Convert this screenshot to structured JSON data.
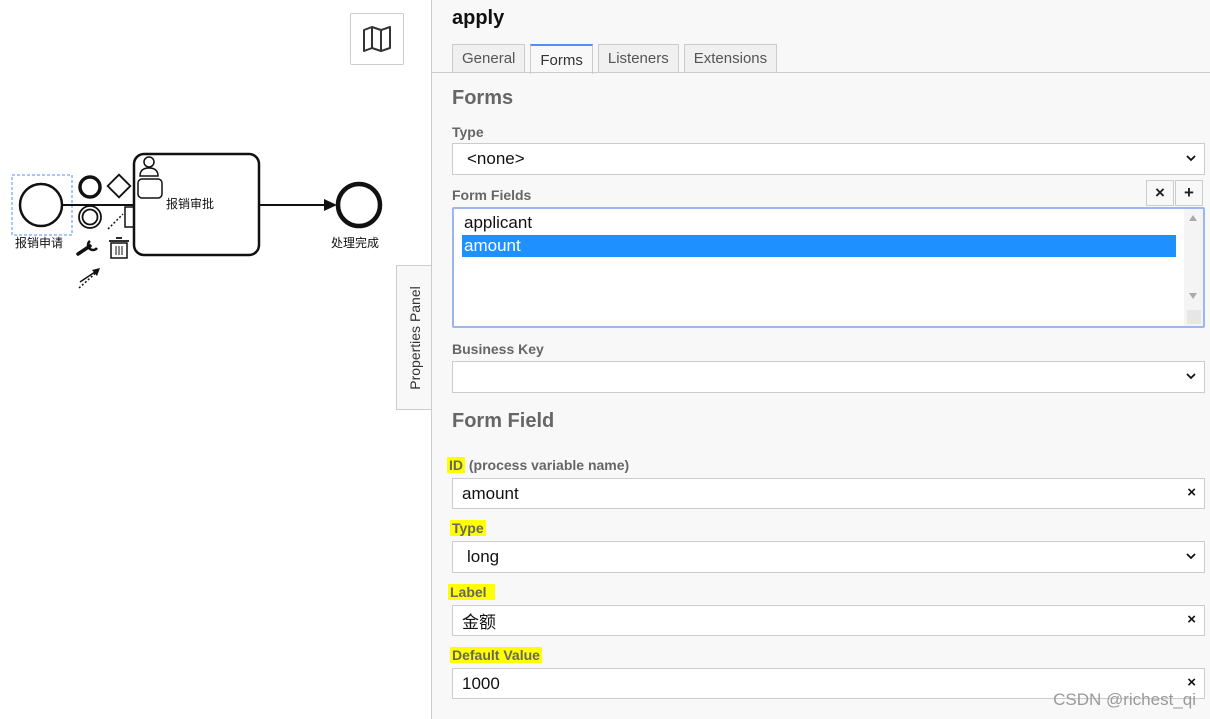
{
  "diagram": {
    "start_event_label": "报销申请",
    "user_task_label": "报销审批",
    "end_event_label": "处理完成",
    "minimap_icon": "map-icon",
    "panel_toggle_label": "Properties Panel"
  },
  "panel": {
    "title": "apply",
    "tabs": [
      {
        "label": "General"
      },
      {
        "label": "Forms"
      },
      {
        "label": "Listeners"
      },
      {
        "label": "Extensions"
      }
    ],
    "active_tab": "Forms",
    "forms_section_title": "Forms",
    "type_label": "Type",
    "type_value": "<none>",
    "form_fields_label": "Form Fields",
    "remove_button": "×",
    "add_button": "+",
    "form_fields": [
      {
        "label": "applicant"
      },
      {
        "label": "amount"
      }
    ],
    "selected_field": "amount",
    "business_key_label": "Business Key",
    "business_key_value": "",
    "form_field_section_title": "Form Field",
    "id_label": "ID",
    "id_label_suffix": "(process variable name)",
    "id_value": "amount",
    "field_type_label": "Type",
    "field_type_value": "long",
    "label_label": "Label",
    "label_value": "金额",
    "default_value_label": "Default Value",
    "default_value": "1000",
    "clear_glyph": "×"
  },
  "watermark": "CSDN @richest_qi",
  "colors": {
    "highlight": "#ffff00",
    "selection": "#1e90ff",
    "active_tab_border": "#4d90fe"
  }
}
